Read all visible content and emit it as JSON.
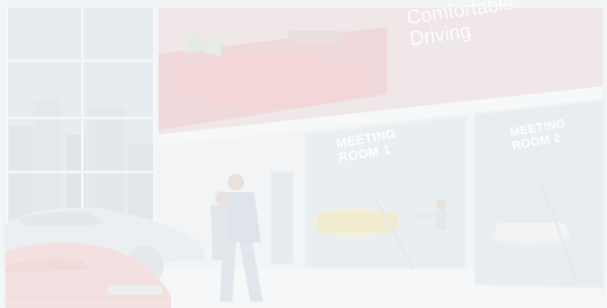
{
  "image": {
    "alt": "Faded showroom scene with glass walls, cars, a walking man, and illuminated meeting room doors",
    "headline": {
      "line1": "Comfortable",
      "line2": "Driving"
    },
    "rooms": [
      {
        "line1": "MEETING",
        "line2": "ROOM 1"
      },
      {
        "line1": "MEETING",
        "line2": "ROOM 2"
      }
    ]
  },
  "colors": {
    "background": "#f3f5f6",
    "glass": "#e8edf0",
    "banner_red": "#f1dcdc",
    "car_red": "#f2e0e0",
    "room_panel": "#eef2f3"
  }
}
